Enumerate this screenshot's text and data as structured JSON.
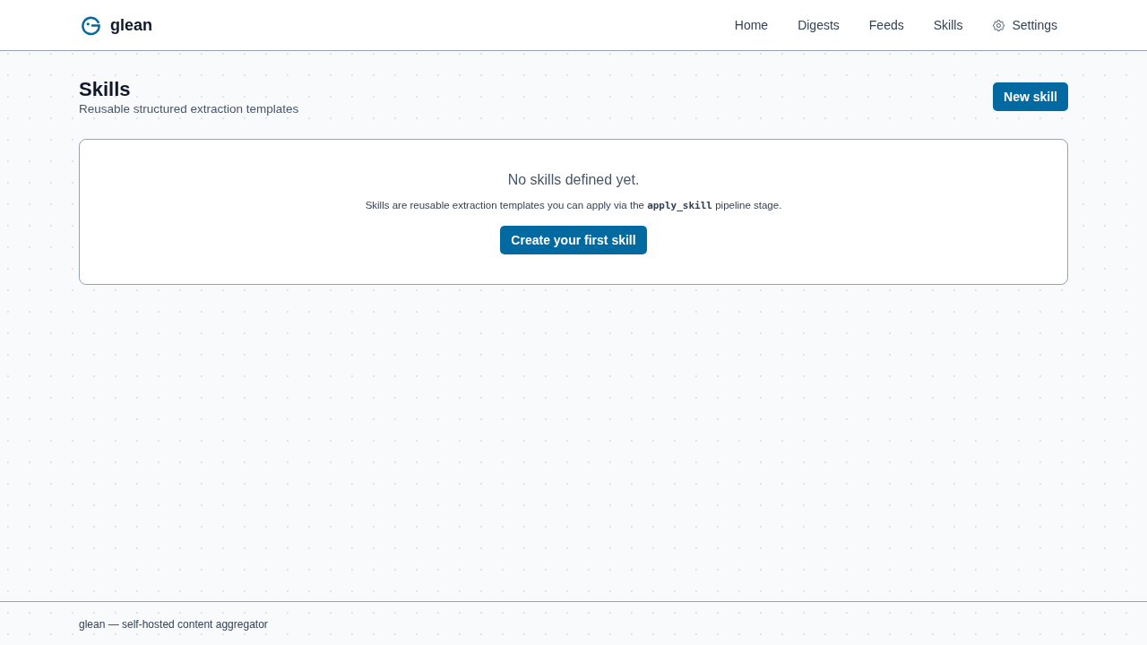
{
  "header": {
    "brand": "glean",
    "nav": [
      {
        "label": "Home",
        "kind": "link"
      },
      {
        "label": "Digests",
        "kind": "link"
      },
      {
        "label": "Feeds",
        "kind": "link"
      },
      {
        "label": "Skills",
        "kind": "link"
      },
      {
        "label": "Settings",
        "kind": "settings"
      }
    ]
  },
  "page": {
    "title": "Skills",
    "subtitle": "Reusable structured extraction templates",
    "new_button": "New skill"
  },
  "empty_state": {
    "heading": "No skills defined yet.",
    "description": [
      {
        "kind": "text",
        "text": "Skills are reusable extraction templates you can apply via the "
      },
      {
        "kind": "code",
        "text": "apply_skill"
      },
      {
        "kind": "text",
        "text": " pipeline stage."
      }
    ],
    "button": "Create your first skill"
  },
  "footer": {
    "text": "glean — self-hosted content aggregator"
  }
}
